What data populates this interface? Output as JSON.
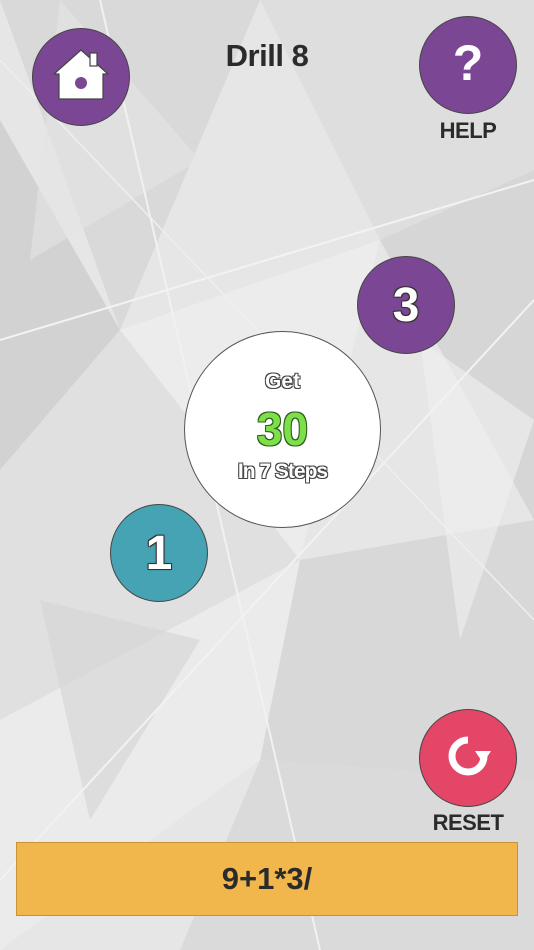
{
  "header": {
    "title": "Drill 8",
    "help_label": "HELP",
    "help_symbol": "?"
  },
  "icons": {
    "home": "home-icon",
    "reset": "refresh-icon"
  },
  "target": {
    "prefix": "Get",
    "goal": "30",
    "steps_text": "In 7 Steps"
  },
  "balls": [
    {
      "value": "3",
      "color": "#7b4795"
    },
    {
      "value": "1",
      "color": "#45a3b3"
    }
  ],
  "controls": {
    "reset_label": "RESET"
  },
  "expression": {
    "text": "9+1*3/"
  },
  "colors": {
    "purple": "#7b4795",
    "teal": "#45a3b3",
    "reset_pink": "#e44668",
    "bar_orange": "#f1b74c",
    "goal_green": "#7de04a"
  }
}
